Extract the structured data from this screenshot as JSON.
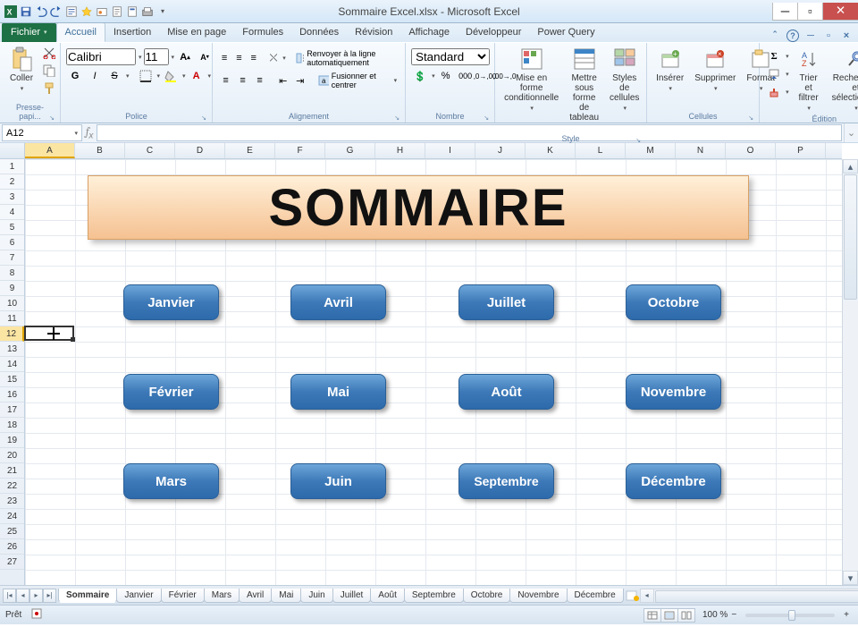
{
  "window": {
    "title": "Sommaire Excel.xlsx - Microsoft Excel"
  },
  "ribbon": {
    "file": "Fichier",
    "tabs": [
      "Accueil",
      "Insertion",
      "Mise en page",
      "Formules",
      "Données",
      "Révision",
      "Affichage",
      "Développeur",
      "Power Query"
    ],
    "active_tab": "Accueil",
    "groups": {
      "clipboard": {
        "label": "Presse-papi...",
        "paste": "Coller"
      },
      "font": {
        "label": "Police",
        "name": "Calibri",
        "size": "11",
        "bold": "G",
        "italic": "I",
        "underline": "S"
      },
      "alignment": {
        "label": "Alignement",
        "wrap": "Renvoyer à la ligne automatiquement",
        "merge": "Fusionner et centrer"
      },
      "number": {
        "label": "Nombre",
        "format": "Standard"
      },
      "style": {
        "label": "Style",
        "cond": "Mise en forme conditionnelle",
        "table": "Mettre sous forme de tableau",
        "cell": "Styles de cellules"
      },
      "cells": {
        "label": "Cellules",
        "insert": "Insérer",
        "delete": "Supprimer",
        "format": "Format"
      },
      "editing": {
        "label": "Édition",
        "sort": "Trier et filtrer",
        "find": "Rechercher et sélectionner"
      }
    }
  },
  "namebox": "A12",
  "sheet": {
    "columns": [
      "A",
      "B",
      "C",
      "D",
      "E",
      "F",
      "G",
      "H",
      "I",
      "J",
      "K",
      "L",
      "M",
      "N",
      "O",
      "P"
    ],
    "active_col": "A",
    "rows": 27,
    "active_row": 12,
    "title_shape": "SOMMAIRE",
    "months": [
      "Janvier",
      "Février",
      "Mars",
      "Avril",
      "Mai",
      "Juin",
      "Juillet",
      "Août",
      "Septembre",
      "Octobre",
      "Novembre",
      "Décembre"
    ]
  },
  "tabs": [
    "Sommaire",
    "Janvier",
    "Février",
    "Mars",
    "Avril",
    "Mai",
    "Juin",
    "Juillet",
    "Août",
    "Septembre",
    "Octobre",
    "Novembre",
    "Décembre"
  ],
  "active_sheet": "Sommaire",
  "status": {
    "ready": "Prêt",
    "zoom": "100 %"
  }
}
